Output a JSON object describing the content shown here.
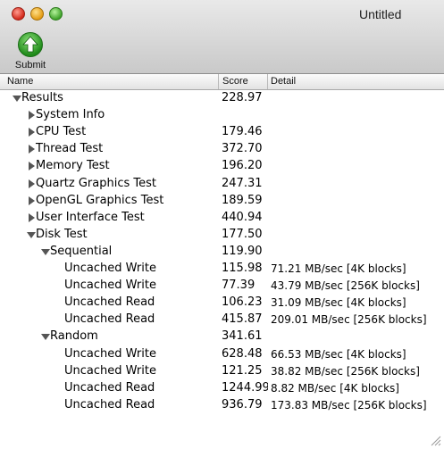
{
  "window": {
    "title": "Untitled"
  },
  "toolbar": {
    "submit_label": "Submit",
    "icon": "green-up-arrow"
  },
  "columns": {
    "name": "Name",
    "score": "Score",
    "detail": "Detail"
  },
  "rows": [
    {
      "name": "Results",
      "score": "228.97",
      "detail": "",
      "indent": 0,
      "state": "expanded"
    },
    {
      "name": "System Info",
      "score": "",
      "detail": "",
      "indent": 1,
      "state": "collapsed"
    },
    {
      "name": "CPU Test",
      "score": "179.46",
      "detail": "",
      "indent": 1,
      "state": "collapsed"
    },
    {
      "name": "Thread Test",
      "score": "372.70",
      "detail": "",
      "indent": 1,
      "state": "collapsed"
    },
    {
      "name": "Memory Test",
      "score": "196.20",
      "detail": "",
      "indent": 1,
      "state": "collapsed"
    },
    {
      "name": "Quartz Graphics Test",
      "score": "247.31",
      "detail": "",
      "indent": 1,
      "state": "collapsed"
    },
    {
      "name": "OpenGL Graphics Test",
      "score": "189.59",
      "detail": "",
      "indent": 1,
      "state": "collapsed"
    },
    {
      "name": "User Interface Test",
      "score": "440.94",
      "detail": "",
      "indent": 1,
      "state": "collapsed"
    },
    {
      "name": "Disk Test",
      "score": "177.50",
      "detail": "",
      "indent": 1,
      "state": "expanded"
    },
    {
      "name": "Sequential",
      "score": "119.90",
      "detail": "",
      "indent": 2,
      "state": "expanded"
    },
    {
      "name": "Uncached Write",
      "score": "115.98",
      "detail": "71.21 MB/sec [4K blocks]",
      "indent": 3,
      "state": "leaf"
    },
    {
      "name": "Uncached Write",
      "score": "77.39",
      "detail": "43.79 MB/sec [256K blocks]",
      "indent": 3,
      "state": "leaf"
    },
    {
      "name": "Uncached Read",
      "score": "106.23",
      "detail": "31.09 MB/sec [4K blocks]",
      "indent": 3,
      "state": "leaf"
    },
    {
      "name": "Uncached Read",
      "score": "415.87",
      "detail": "209.01 MB/sec [256K blocks]",
      "indent": 3,
      "state": "leaf"
    },
    {
      "name": "Random",
      "score": "341.61",
      "detail": "",
      "indent": 2,
      "state": "expanded"
    },
    {
      "name": "Uncached Write",
      "score": "628.48",
      "detail": "66.53 MB/sec [4K blocks]",
      "indent": 3,
      "state": "leaf"
    },
    {
      "name": "Uncached Write",
      "score": "121.25",
      "detail": "38.82 MB/sec [256K blocks]",
      "indent": 3,
      "state": "leaf"
    },
    {
      "name": "Uncached Read",
      "score": "1244.99",
      "detail": "8.82 MB/sec [4K blocks]",
      "indent": 3,
      "state": "leaf"
    },
    {
      "name": "Uncached Read",
      "score": "936.79",
      "detail": "173.83 MB/sec [256K blocks]",
      "indent": 3,
      "state": "leaf"
    }
  ]
}
